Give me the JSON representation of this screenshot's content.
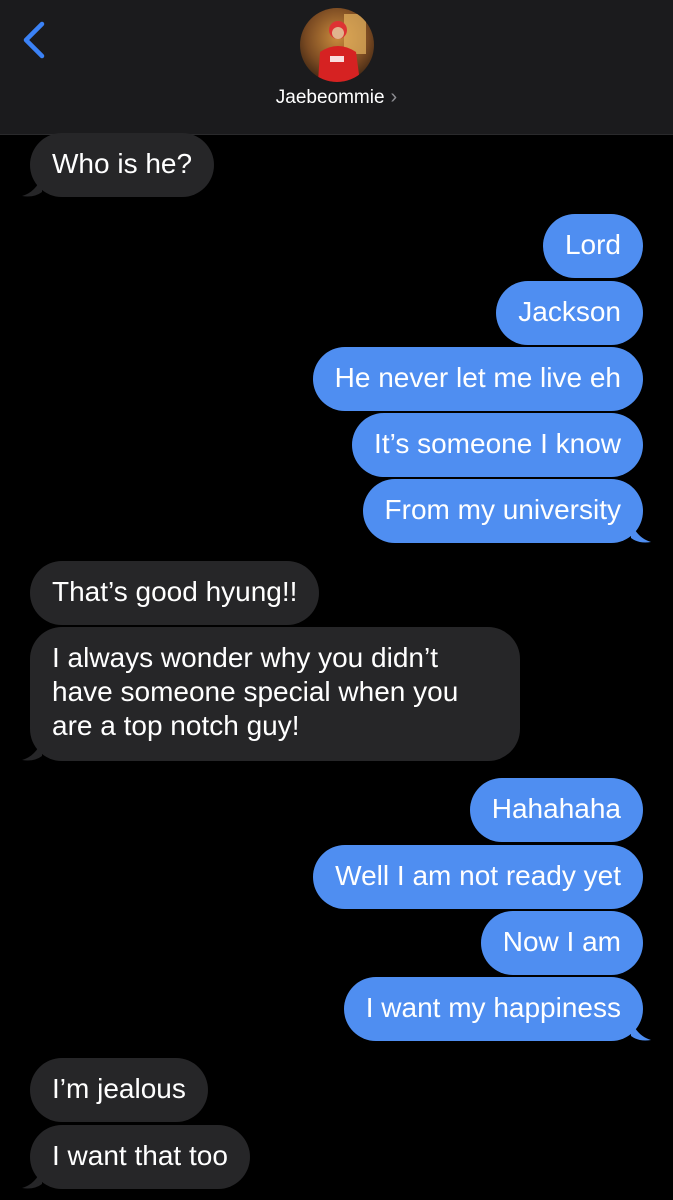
{
  "header": {
    "contact_name": "Jaebeommie",
    "back_icon": "chevron-left-icon",
    "accent_color": "#3b82f6"
  },
  "messages": [
    {
      "direction": "incoming",
      "text": "Who is he?"
    },
    {
      "direction": "outgoing",
      "text": "Lord"
    },
    {
      "direction": "outgoing",
      "text": "Jackson"
    },
    {
      "direction": "outgoing",
      "text": "He never let me live eh"
    },
    {
      "direction": "outgoing",
      "text": "It’s someone I know"
    },
    {
      "direction": "outgoing",
      "text": "From my university"
    },
    {
      "direction": "incoming",
      "text": "That’s good hyung!!"
    },
    {
      "direction": "incoming",
      "lines": [
        "I always wonder why you didn’t",
        "have someone special when you",
        "are a top notch guy!"
      ]
    },
    {
      "direction": "outgoing",
      "text": "Hahahaha"
    },
    {
      "direction": "outgoing",
      "text": "Well I am not ready yet"
    },
    {
      "direction": "outgoing",
      "text": "Now I am"
    },
    {
      "direction": "outgoing",
      "text": "I want my happiness"
    },
    {
      "direction": "incoming",
      "text": "I’m jealous"
    },
    {
      "direction": "incoming",
      "text": "I want that too"
    }
  ],
  "colors": {
    "incoming_bubble": "#262628",
    "outgoing_bubble": "#4f8ef1",
    "background": "#000000"
  }
}
